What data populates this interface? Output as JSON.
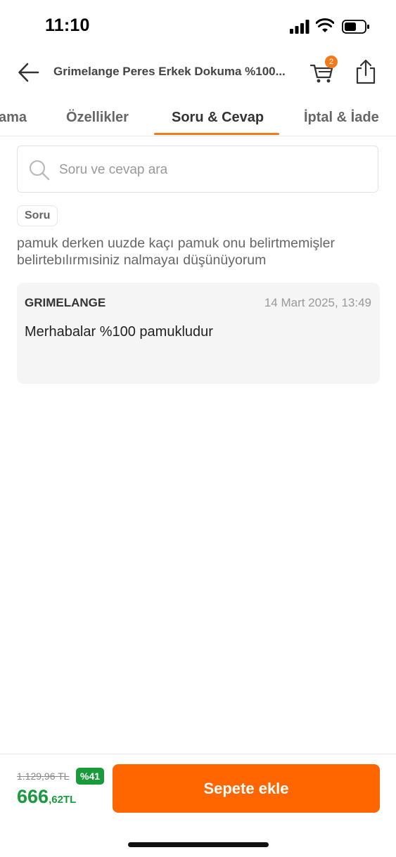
{
  "status_bar": {
    "time": "11:10"
  },
  "header": {
    "title": "Grimelange Peres Erkek Dokuma %100...",
    "cart_count": "2"
  },
  "tabs": [
    {
      "label": "ama"
    },
    {
      "label": "Özellikler"
    },
    {
      "label": "Soru & Cevap"
    },
    {
      "label": "İptal & İade"
    }
  ],
  "search": {
    "placeholder": "Soru ve cevap ara"
  },
  "question": {
    "badge": "Soru",
    "text": "pamuk derken uuzde kaçı pamuk onu belirtmemişler belirtebılırmısiniz nalmayaı düşünüyorum"
  },
  "answer": {
    "seller": "GRIMELANGE",
    "date": "14 Mart 2025, 13:49",
    "text": "Merhabalar %100 pamukludur"
  },
  "footer": {
    "old_price": "1.129,96 TL",
    "discount": "%41",
    "price_main": "666",
    "price_decimal": ",62TL",
    "add_to_cart": "Sepete ekle"
  },
  "colors": {
    "accent": "#f27a1a",
    "button": "#ff6600",
    "price": "#1a9b3b"
  }
}
